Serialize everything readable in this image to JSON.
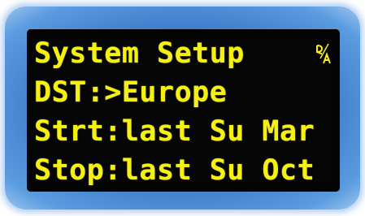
{
  "display": {
    "title": "System Setup",
    "dst_line": "DST:>Europe",
    "start_line": "Strt:last Su Mar",
    "stop_line": "Stop:last Su Oct"
  },
  "icons": {
    "mode_indicator": "manual-auto-indicator-icon"
  },
  "colors": {
    "bezel": "#3f7fcb",
    "screen": "#050505",
    "text": "#f5f010"
  }
}
